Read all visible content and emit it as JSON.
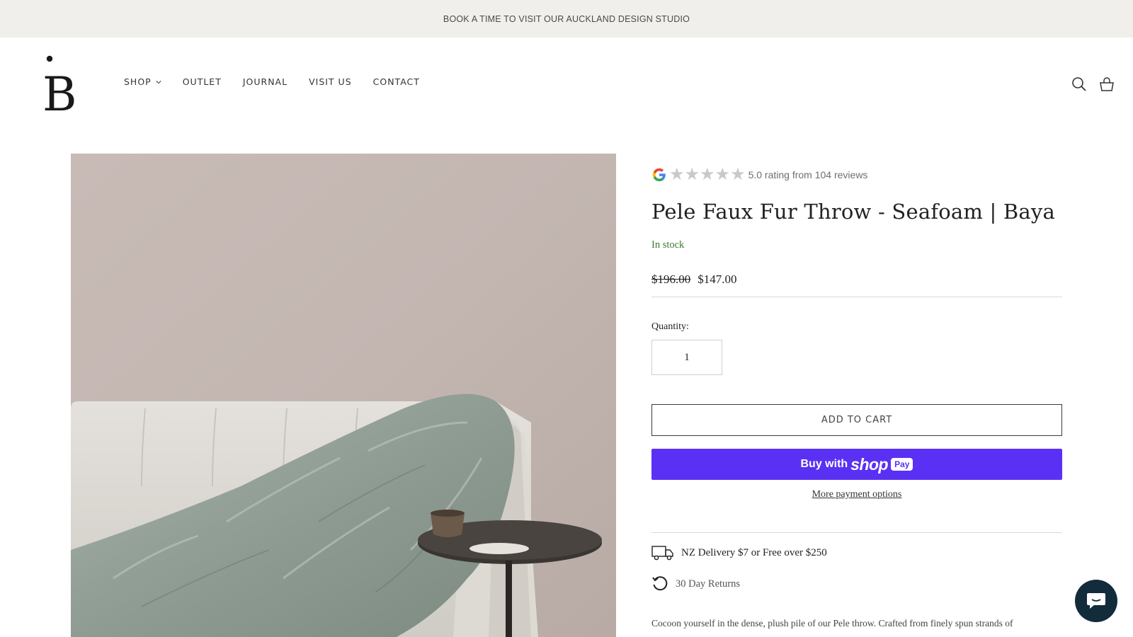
{
  "announcement": {
    "text": "BOOK A TIME TO VISIT OUR AUCKLAND DESIGN STUDIO"
  },
  "brand": {
    "logo_text": "B"
  },
  "nav": {
    "items": [
      {
        "label": "SHOP",
        "has_dropdown": true
      },
      {
        "label": "OUTLET"
      },
      {
        "label": "JOURNAL"
      },
      {
        "label": "VISIT US"
      },
      {
        "label": "CONTACT"
      }
    ]
  },
  "header_icons": [
    "search-icon",
    "cart-icon"
  ],
  "product": {
    "rating_stars": 5,
    "rating_text": "5.0 rating from 104 reviews",
    "title": "Pele Faux Fur Throw - Seafoam | Baya",
    "stock": "In stock",
    "compare_price": "$196.00",
    "price": "$147.00",
    "quantity_label": "Quantity:",
    "quantity_value": "1",
    "add_to_cart": "ADD TO CART",
    "buy_with": "Buy with",
    "shop_brand": "shop",
    "pay_badge": "Pay",
    "more_payment": "More payment options",
    "features": [
      {
        "icon": "truck-icon",
        "text": "NZ Delivery $7 or Free over $250"
      },
      {
        "icon": "returns-icon",
        "text": "30 Day Returns"
      }
    ],
    "description_partial": "Cocoon yourself in the dense, plush pile of our Pele throw. Crafted from finely spun strands of"
  },
  "colors": {
    "announcement_bg": "#f1efeb",
    "in_stock_green": "#3b7a2e",
    "shop_pay_purple": "#5a31f4",
    "chat_button": "#122c3c"
  }
}
